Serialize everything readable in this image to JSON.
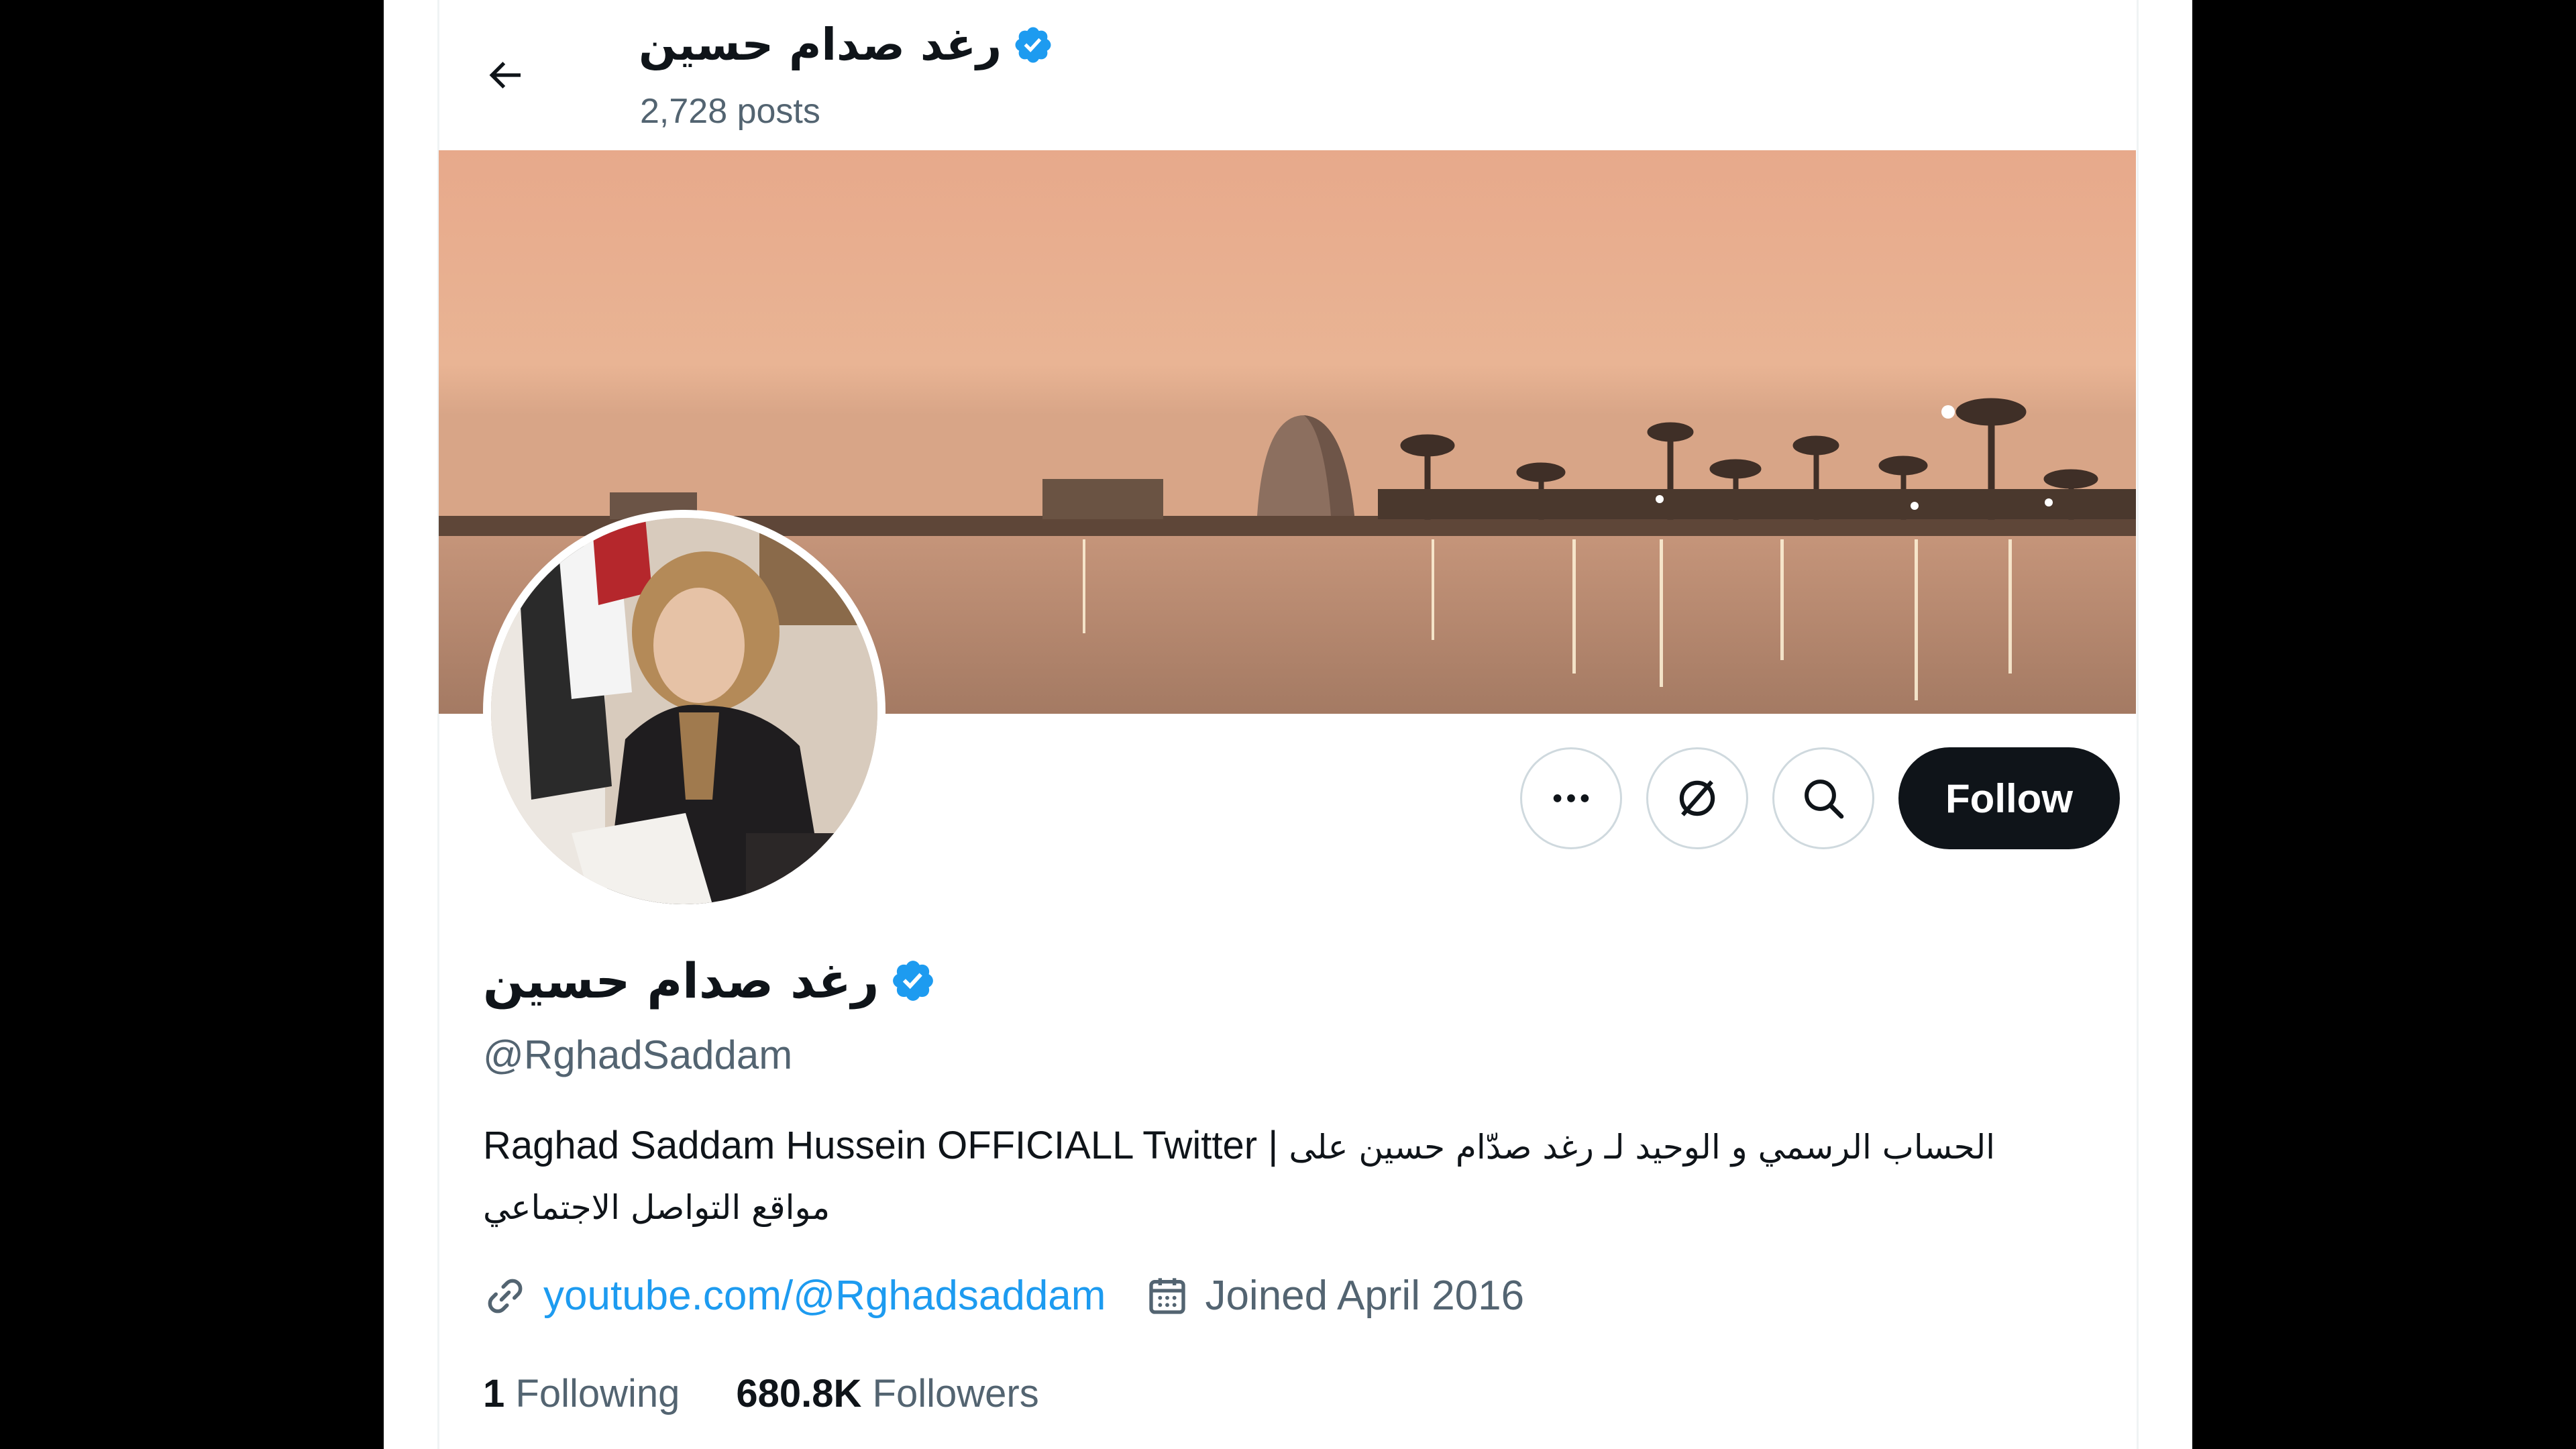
{
  "header": {
    "name": "رغد صدام حسين",
    "posts": "2,728 posts"
  },
  "profile": {
    "name": "رغد صدام حسين",
    "handle": "@RghadSaddam",
    "bio_latin": "Raghad Saddam Hussein OFFICIALL Twitter |",
    "bio_arabic_line1": "الحساب الرسمي و الوحيد لـ رغد صدّام حسين على",
    "bio_arabic_line2": "مواقع التواصل الاجتماعي",
    "website": "youtube.com/@Rghadsaddam",
    "joined": "Joined April 2016",
    "following_count": "1",
    "following_label": "Following",
    "followers_count": "680.8K",
    "followers_label": "Followers"
  },
  "actions": {
    "follow_label": "Follow"
  },
  "icons": [
    "back-arrow-icon",
    "verified-badge-icon",
    "more-icon",
    "grok-icon",
    "search-icon",
    "link-icon",
    "calendar-icon"
  ],
  "colors": {
    "accent": "#1d9bf0",
    "text": "#0f1419",
    "muted": "#536471",
    "follow_bg": "#0f1419"
  }
}
